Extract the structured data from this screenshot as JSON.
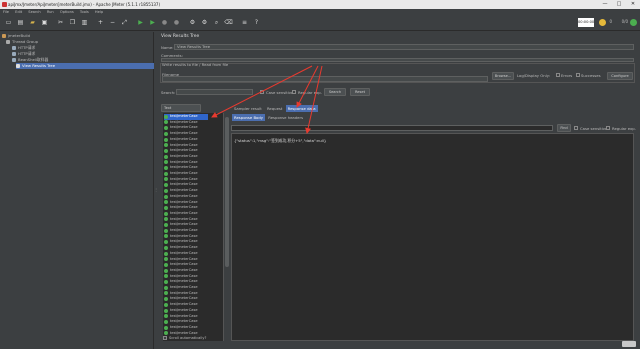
{
  "window": {
    "title": "apiJmx/Jmeter/ApiJmeter/jmeterBuild.jmx) - Apache JMeter (5.1.1 r1855137)",
    "min": "—",
    "max": "□",
    "close": "✕"
  },
  "menu": [
    "File",
    "Edit",
    "Search",
    "Run",
    "Options",
    "Tools",
    "Help"
  ],
  "toolbar": {
    "timer": "00:00:00",
    "warn_count": "0",
    "threads": "0/0"
  },
  "tree": [
    {
      "label": "jmeterBuild",
      "icon": "testplan-icon",
      "indent": 0
    },
    {
      "label": "Thread Group",
      "icon": "thread-group-icon",
      "indent": 1
    },
    {
      "label": "HTTP请求",
      "icon": "sampler-icon",
      "indent": 2
    },
    {
      "label": "HTTP请求",
      "icon": "sampler-icon",
      "indent": 2
    },
    {
      "label": "BeanShell取样器",
      "icon": "sampler-icon",
      "indent": 2
    },
    {
      "label": "View Results Tree",
      "icon": "listener-icon",
      "indent": 3,
      "selected": true
    }
  ],
  "panel": {
    "title": "View Results Tree",
    "name_label": "Name:",
    "name_value": "View Results Tree",
    "comments_label": "Comments:",
    "write_label": "Write results to file / Read from file",
    "filename_label": "Filename",
    "browse": "Browse...",
    "log_errors": "Log/Display Only:",
    "errors": "Errors",
    "successes": "Successes",
    "configure": "Configure",
    "search_label": "Search:",
    "case_sensitive": "Case sensitive",
    "regular_exp": "Regular exp.",
    "search_btn": "Search",
    "reset_btn": "Reset",
    "text_selector": "Text"
  },
  "tabs": [
    "Sampler result",
    "Request",
    "Response data"
  ],
  "subtabs": [
    "Response Body",
    "Response headers"
  ],
  "find": {
    "find_btn": "Find",
    "case_sensitive": "Case sensitive",
    "regular_exp": "Regular exp."
  },
  "response_body": "{\"status\":1,\"msg\":\"签到成功,积分+5\",\"data\":null}",
  "results": [
    "testJmeterCase",
    "testJmeterCase",
    "testJmeterCase",
    "testJmeterCase",
    "testJmeterCase",
    "testJmeterCase",
    "testJmeterCase",
    "testJmeterCase",
    "testJmeterCase",
    "testJmeterCase",
    "testJmeterCase",
    "testJmeterCase",
    "testJmeterCase",
    "testJmeterCase",
    "testJmeterCase",
    "testJmeterCase",
    "testJmeterCase",
    "testJmeterCase",
    "testJmeterCase",
    "testJmeterCase",
    "testJmeterCase",
    "testJmeterCase",
    "testJmeterCase",
    "testJmeterCase",
    "testJmeterCase",
    "testJmeterCase",
    "testJmeterCase",
    "testJmeterCase",
    "testJmeterCase",
    "testJmeterCase",
    "testJmeterCase",
    "testJmeterCase",
    "testJmeterCase",
    "testJmeterCase",
    "testJmeterCase",
    "testJmeterCase",
    "testJmeterCase",
    "testJmeterCase",
    "testJmeterCase"
  ],
  "scroll_auto": "Scroll automatically?",
  "colors": {
    "accent": "#4b6eaf",
    "selection": "#2f65ca",
    "ok": "#4caf50",
    "arrow": "#e83a2f"
  }
}
